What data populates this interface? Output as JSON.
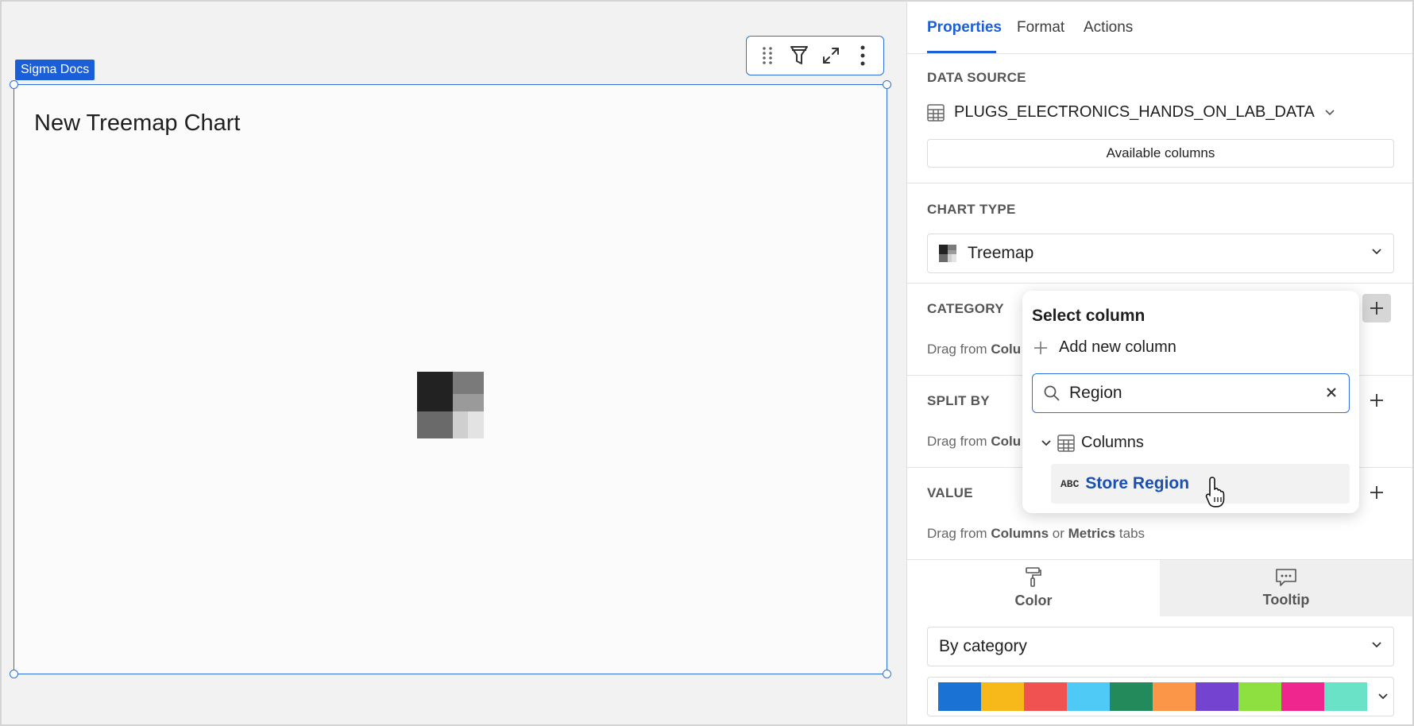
{
  "canvas": {
    "tag": "Sigma Docs",
    "chart_title": "New Treemap Chart"
  },
  "toolbar_icons": [
    "drag-handle-icon",
    "filter-icon",
    "expand-icon",
    "more-icon"
  ],
  "panel": {
    "tabs": [
      {
        "label": "Properties",
        "active": true
      },
      {
        "label": "Format",
        "active": false
      },
      {
        "label": "Actions",
        "active": false
      }
    ],
    "data_source": {
      "label": "DATA SOURCE",
      "name": "PLUGS_ELECTRONICS_HANDS_ON_LAB_DATA",
      "available_columns_label": "Available columns"
    },
    "chart_type": {
      "label": "CHART TYPE",
      "value": "Treemap"
    },
    "category": {
      "label": "CATEGORY",
      "hint_prefix": "Drag from",
      "hint_bold": "Colu"
    },
    "split_by": {
      "label": "SPLIT BY",
      "hint_prefix": "Drag from",
      "hint_bold": "Colu"
    },
    "value": {
      "label": "VALUE",
      "hint_prefix": "Drag from",
      "hint_cols": "Columns",
      "hint_or": "or",
      "hint_metrics": "Metrics",
      "hint_suffix": "tabs"
    },
    "subtabs": [
      {
        "label": "Color",
        "icon": "paint-roller-icon",
        "active": true
      },
      {
        "label": "Tooltip",
        "icon": "tooltip-icon",
        "active": false
      }
    ],
    "color_mode": "By category",
    "palette": [
      "#1a73d4",
      "#f7b81a",
      "#f05252",
      "#4fcaf7",
      "#238b5b",
      "#fb9547",
      "#7443d0",
      "#8de03f",
      "#f0268f",
      "#69e2c7"
    ]
  },
  "popover": {
    "title": "Select column",
    "add_new_label": "Add new column",
    "search_value": "Region",
    "group_label": "Columns",
    "result_type": "ABC",
    "result_name": "Store Region"
  }
}
